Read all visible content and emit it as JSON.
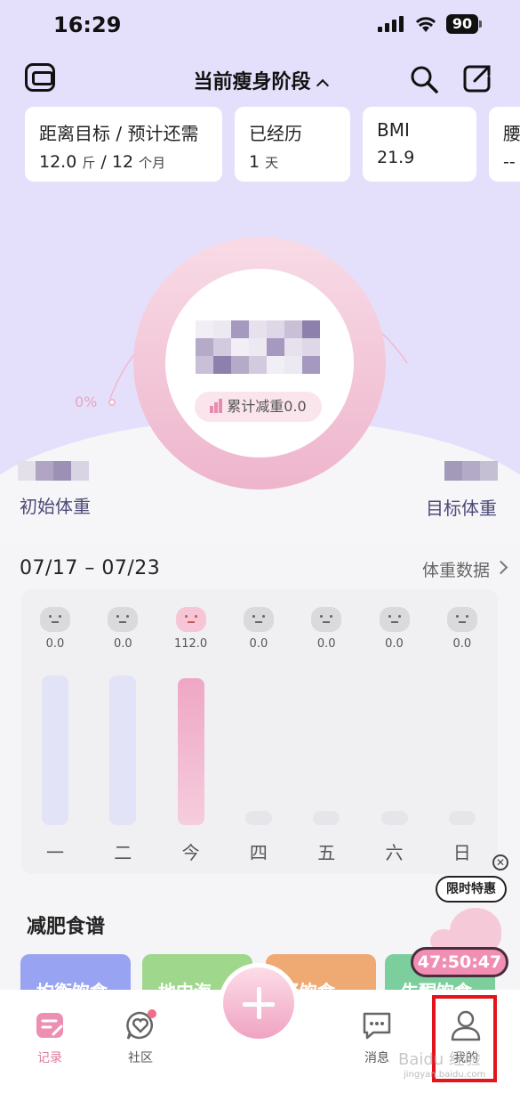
{
  "status": {
    "time": "16:29",
    "battery": "90"
  },
  "header": {
    "stage": "当前瘦身阶段"
  },
  "cards": [
    {
      "label": "距离目标 / 预计还需",
      "value_a": "12.0",
      "unit_a": "斤",
      "sep": "/",
      "value_b": "12",
      "unit_b": "个月"
    },
    {
      "label": "已经历",
      "value_a": "1",
      "unit_a": "天"
    },
    {
      "label": "BMI",
      "value_a": "21.9"
    },
    {
      "label": "腰",
      "value_a": "--"
    }
  ],
  "progress": {
    "percent_label": "0%",
    "total_loss": "累计减重0.0"
  },
  "weights": {
    "start_label": "初始体重",
    "target_label": "目标体重"
  },
  "week": {
    "range": "07/17 – 07/23",
    "link": "体重数据"
  },
  "chart_data": {
    "type": "bar",
    "categories": [
      "一",
      "二",
      "今",
      "四",
      "五",
      "六",
      "日"
    ],
    "values": [
      0.0,
      0.0,
      112.0,
      0.0,
      0.0,
      0.0,
      0.0
    ],
    "value_labels": [
      "0.0",
      "0.0",
      "112.0",
      "0.0",
      "0.0",
      "0.0",
      "0.0"
    ],
    "today_index": 2,
    "colors": {
      "empty": "#e2e3f7",
      "today": "#efa6c4",
      "none": "#e6e6ea"
    }
  },
  "diet": {
    "title": "减肥食谱",
    "tabs": [
      {
        "label": "均衡饮食",
        "color": "#98a4f1"
      },
      {
        "label": "地中海",
        "color": "#9fd78c"
      },
      {
        "label": "轻饮食",
        "color": "#efaa74"
      },
      {
        "label": "生酮饮食",
        "color": "#7ccf9c"
      }
    ]
  },
  "promo": {
    "badge": "限时特惠",
    "timer": "47:50:47"
  },
  "tabbar": {
    "items": [
      {
        "label": "记录"
      },
      {
        "label": "社区"
      },
      {
        "label": "消息"
      },
      {
        "label": "我的"
      }
    ]
  },
  "colors": {
    "accent": "#e07ba1",
    "hero_bg": "#e4e0fb",
    "highlight": "#e3141c"
  }
}
